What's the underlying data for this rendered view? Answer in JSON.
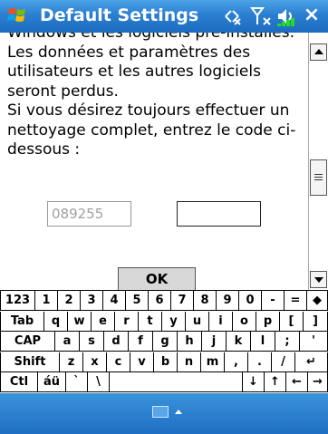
{
  "window": {
    "title": "Default Settings",
    "close_label": "×"
  },
  "content": {
    "paragraph": "Windows et les logiciels pré-installés.\nLes données et paramètres des\nutilisateurs et les autres logiciels\nseront perdus.\nSi vous désirez toujours effectuer un\nnettoyage complet, entrez le code ci-\ndessous :",
    "code_display": "089255",
    "code_input_value": "",
    "ok_label": "OK"
  },
  "keyboard": {
    "rows": [
      [
        "123",
        "1",
        "2",
        "3",
        "4",
        "5",
        "6",
        "7",
        "8",
        "9",
        "0",
        "-",
        "=",
        "◆"
      ],
      [
        "Tab",
        "q",
        "w",
        "e",
        "r",
        "t",
        "y",
        "u",
        "i",
        "o",
        "p",
        "[",
        "]"
      ],
      [
        "CAP",
        "a",
        "s",
        "d",
        "f",
        "g",
        "h",
        "j",
        "k",
        "l",
        ";",
        "'"
      ],
      [
        "Shift",
        "z",
        "x",
        "c",
        "v",
        "b",
        "n",
        "m",
        ",",
        ".",
        "/",
        "↵"
      ],
      [
        "Ctl",
        "áü",
        "`",
        "\\",
        "",
        "↓",
        "↑",
        "←",
        "→"
      ]
    ]
  },
  "colors": {
    "titlebar": "#2b7fd0",
    "taskbar": "#1e6fc4"
  },
  "icons": {
    "start": "windows-flag-icon",
    "connectivity": "connectivity-icon",
    "signal": "signal-icon",
    "volume": "volume-icon",
    "sip": "keyboard-icon"
  }
}
